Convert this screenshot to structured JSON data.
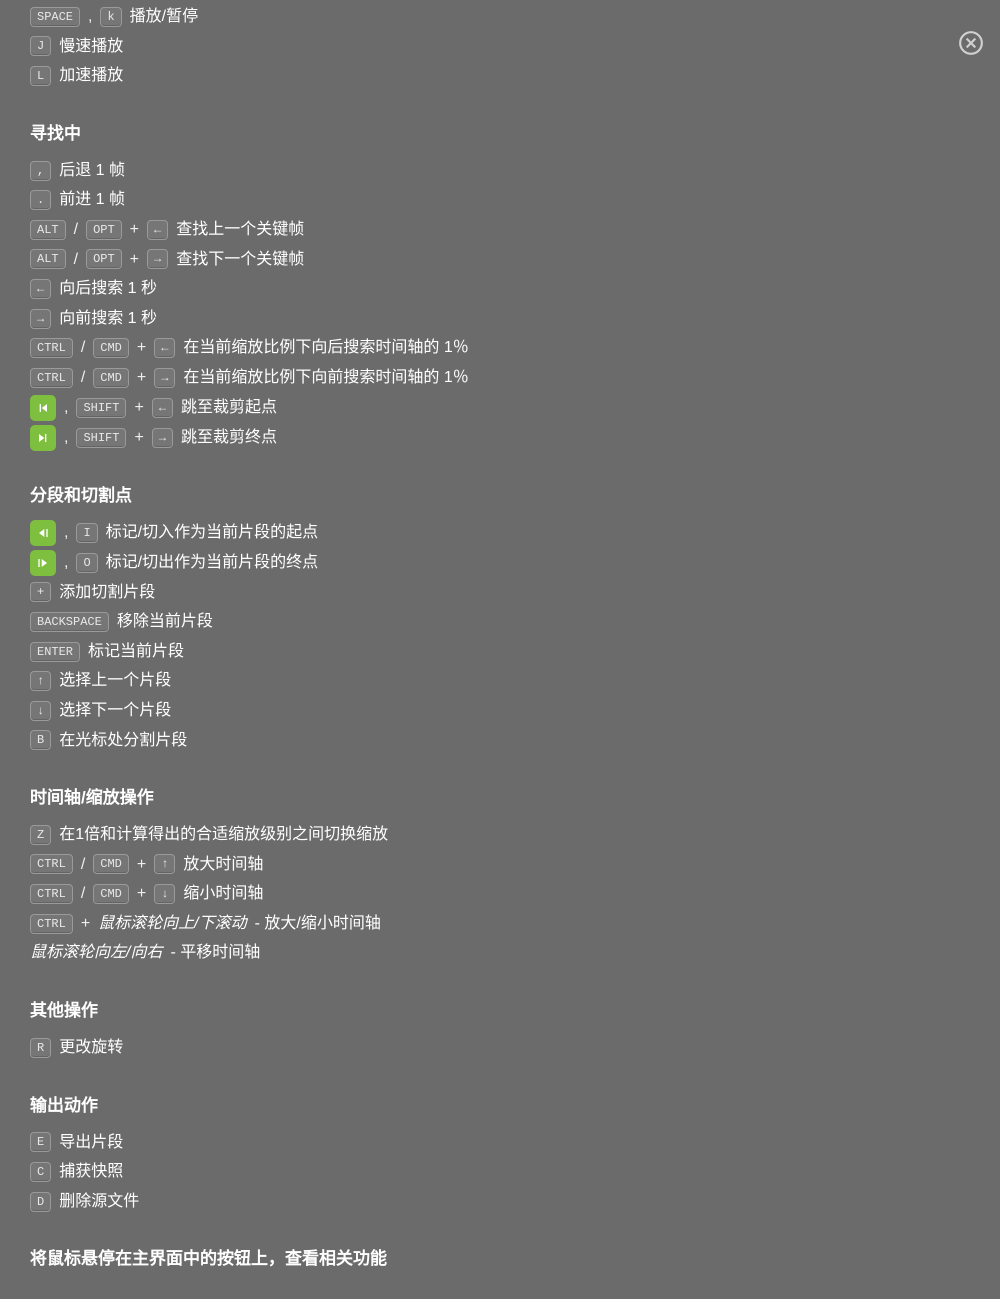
{
  "close_label": "Close",
  "playback": {
    "rows": [
      {
        "keys": [
          {
            "t": "kbd",
            "v": "SPACE"
          },
          {
            "t": "sep",
            "v": ","
          },
          {
            "t": "kbd",
            "v": "k"
          }
        ],
        "desc": "播放/暂停"
      },
      {
        "keys": [
          {
            "t": "kbd",
            "v": "J"
          }
        ],
        "desc": "慢速播放"
      },
      {
        "keys": [
          {
            "t": "kbd",
            "v": "L"
          }
        ],
        "desc": "加速播放"
      }
    ]
  },
  "seeking": {
    "heading": "寻找中",
    "rows": [
      {
        "keys": [
          {
            "t": "kbd",
            "v": ","
          }
        ],
        "desc": "后退 1 帧"
      },
      {
        "keys": [
          {
            "t": "kbd",
            "v": "."
          }
        ],
        "desc": "前进 1 帧"
      },
      {
        "keys": [
          {
            "t": "kbd",
            "v": "ALT"
          },
          {
            "t": "sep",
            "v": "/"
          },
          {
            "t": "kbd",
            "v": "OPT"
          },
          {
            "t": "sep",
            "v": "+"
          },
          {
            "t": "kbd",
            "v": "←"
          }
        ],
        "desc": "查找上一个关键帧"
      },
      {
        "keys": [
          {
            "t": "kbd",
            "v": "ALT"
          },
          {
            "t": "sep",
            "v": "/"
          },
          {
            "t": "kbd",
            "v": "OPT"
          },
          {
            "t": "sep",
            "v": "+"
          },
          {
            "t": "kbd",
            "v": "→"
          }
        ],
        "desc": "查找下一个关键帧"
      },
      {
        "keys": [
          {
            "t": "kbd",
            "v": "←"
          }
        ],
        "desc": "向后搜索 1 秒"
      },
      {
        "keys": [
          {
            "t": "kbd",
            "v": "→"
          }
        ],
        "desc": "向前搜索 1 秒"
      },
      {
        "keys": [
          {
            "t": "kbd",
            "v": "CTRL"
          },
          {
            "t": "sep",
            "v": "/"
          },
          {
            "t": "kbd",
            "v": "CMD"
          },
          {
            "t": "sep",
            "v": "+"
          },
          {
            "t": "kbd",
            "v": "←"
          }
        ],
        "desc": "在当前缩放比例下向后搜索时间轴的 1％"
      },
      {
        "keys": [
          {
            "t": "kbd",
            "v": "CTRL"
          },
          {
            "t": "sep",
            "v": "/"
          },
          {
            "t": "kbd",
            "v": "CMD"
          },
          {
            "t": "sep",
            "v": "+"
          },
          {
            "t": "kbd",
            "v": "→"
          }
        ],
        "desc": "在当前缩放比例下向前搜索时间轴的 1％"
      },
      {
        "keys": [
          {
            "t": "icon",
            "v": "skip-start"
          },
          {
            "t": "sep",
            "v": ","
          },
          {
            "t": "kbd",
            "v": "SHIFT"
          },
          {
            "t": "sep",
            "v": "+"
          },
          {
            "t": "kbd",
            "v": "←"
          }
        ],
        "desc": "跳至裁剪起点"
      },
      {
        "keys": [
          {
            "t": "icon",
            "v": "skip-end"
          },
          {
            "t": "sep",
            "v": ","
          },
          {
            "t": "kbd",
            "v": "SHIFT"
          },
          {
            "t": "sep",
            "v": "+"
          },
          {
            "t": "kbd",
            "v": "→"
          }
        ],
        "desc": "跳至裁剪终点"
      }
    ]
  },
  "segments": {
    "heading": "分段和切割点",
    "rows": [
      {
        "keys": [
          {
            "t": "icon",
            "v": "cut-in"
          },
          {
            "t": "sep",
            "v": ","
          },
          {
            "t": "kbd",
            "v": "I"
          }
        ],
        "desc": "标记/切入作为当前片段的起点"
      },
      {
        "keys": [
          {
            "t": "icon",
            "v": "cut-out"
          },
          {
            "t": "sep",
            "v": ","
          },
          {
            "t": "kbd",
            "v": "O"
          }
        ],
        "desc": "标记/切出作为当前片段的终点"
      },
      {
        "keys": [
          {
            "t": "kbd",
            "v": "+"
          }
        ],
        "desc": "添加切割片段"
      },
      {
        "keys": [
          {
            "t": "kbd",
            "v": "BACKSPACE"
          }
        ],
        "desc": "移除当前片段"
      },
      {
        "keys": [
          {
            "t": "kbd",
            "v": "ENTER"
          }
        ],
        "desc": "标记当前片段"
      },
      {
        "keys": [
          {
            "t": "kbd",
            "v": "↑"
          }
        ],
        "desc": "选择上一个片段"
      },
      {
        "keys": [
          {
            "t": "kbd",
            "v": "↓"
          }
        ],
        "desc": "选择下一个片段"
      },
      {
        "keys": [
          {
            "t": "kbd",
            "v": "B"
          }
        ],
        "desc": "在光标处分割片段"
      }
    ]
  },
  "timeline": {
    "heading": "时间轴/缩放操作",
    "rows": [
      {
        "keys": [
          {
            "t": "kbd",
            "v": "Z"
          }
        ],
        "desc": "在1倍和计算得出的合适缩放级别之间切换缩放"
      },
      {
        "keys": [
          {
            "t": "kbd",
            "v": "CTRL"
          },
          {
            "t": "sep",
            "v": "/"
          },
          {
            "t": "kbd",
            "v": "CMD"
          },
          {
            "t": "sep",
            "v": "+"
          },
          {
            "t": "kbd",
            "v": "↑"
          }
        ],
        "desc": "放大时间轴"
      },
      {
        "keys": [
          {
            "t": "kbd",
            "v": "CTRL"
          },
          {
            "t": "sep",
            "v": "/"
          },
          {
            "t": "kbd",
            "v": "CMD"
          },
          {
            "t": "sep",
            "v": "+"
          },
          {
            "t": "kbd",
            "v": "↓"
          }
        ],
        "desc": "缩小时间轴"
      },
      {
        "keys": [
          {
            "t": "kbd",
            "v": "CTRL"
          },
          {
            "t": "sep",
            "v": "+"
          },
          {
            "t": "italic",
            "v": "鼠标滚轮向上/下滚动"
          }
        ],
        "desc": "- 放大/缩小时间轴"
      },
      {
        "keys": [
          {
            "t": "italic",
            "v": "鼠标滚轮向左/向右"
          }
        ],
        "desc": "- 平移时间轴"
      }
    ]
  },
  "other": {
    "heading": "其他操作",
    "rows": [
      {
        "keys": [
          {
            "t": "kbd",
            "v": "R"
          }
        ],
        "desc": "更改旋转"
      }
    ]
  },
  "output": {
    "heading": "输出动作",
    "rows": [
      {
        "keys": [
          {
            "t": "kbd",
            "v": "E"
          }
        ],
        "desc": "导出片段"
      },
      {
        "keys": [
          {
            "t": "kbd",
            "v": "C"
          }
        ],
        "desc": "捕获快照"
      },
      {
        "keys": [
          {
            "t": "kbd",
            "v": "D"
          }
        ],
        "desc": "删除源文件"
      }
    ]
  },
  "footer": "将鼠标悬停在主界面中的按钮上，查看相关功能"
}
